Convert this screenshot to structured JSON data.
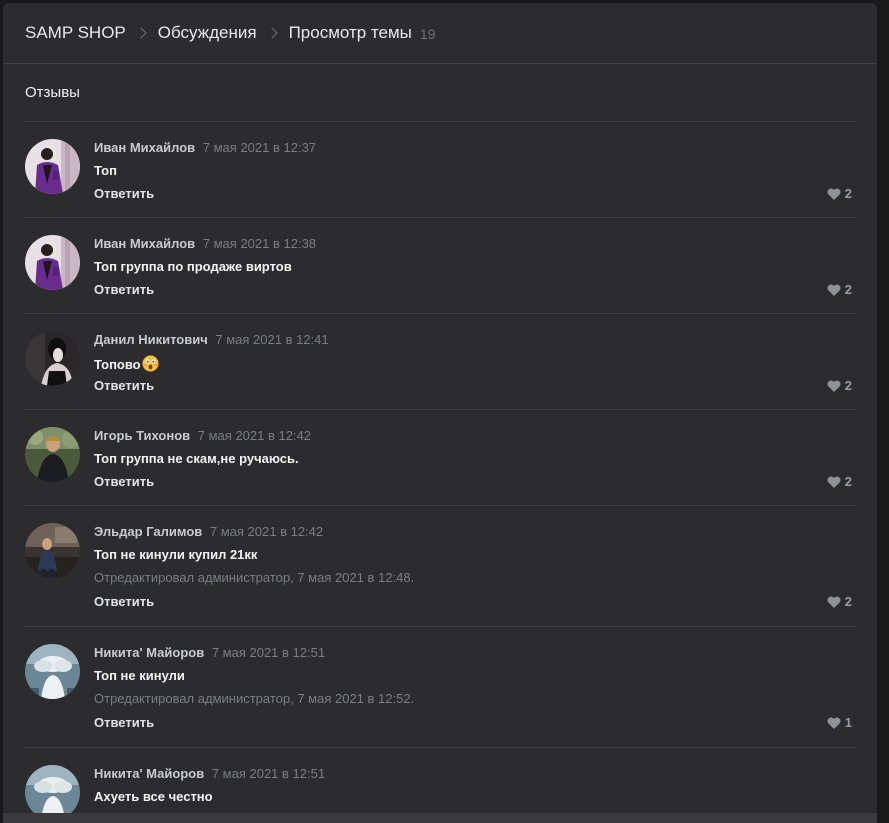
{
  "breadcrumb": {
    "items": [
      "SAMP SHOP",
      "Обсуждения",
      "Просмотр темы"
    ],
    "count": "19"
  },
  "topic": {
    "title": "Отзывы"
  },
  "comments": [
    {
      "author": "Иван Михайлов",
      "date": "7 мая 2021 в 12:37",
      "text": "Топ",
      "edited": "",
      "reply": "Ответить",
      "likes": "2",
      "avatar": "purple"
    },
    {
      "author": "Иван Михайлов",
      "date": "7 мая 2021 в 12:38",
      "text": "Топ группа по продаже виртов",
      "edited": "",
      "reply": "Ответить",
      "likes": "2",
      "avatar": "purple"
    },
    {
      "author": "Данил Никитович",
      "date": "7 мая 2021 в 12:41",
      "text": "Топово",
      "edited": "",
      "reply": "Ответить",
      "likes": "2",
      "avatar": "dark"
    },
    {
      "author": "Игорь Тихонов",
      "date": "7 мая 2021 в 12:42",
      "text": "Топ группа не скам,не ручаюсь.",
      "edited": "",
      "reply": "Ответить",
      "likes": "2",
      "avatar": "green"
    },
    {
      "author": "Эльдар Галимов",
      "date": "7 мая 2021 в 12:42",
      "text": "Топ не кинули купил 21кк",
      "edited": "Отредактировал администратор, 7 мая 2021 в 12:48.",
      "reply": "Ответить",
      "likes": "2",
      "avatar": "street"
    },
    {
      "author": "Никита' Майоров",
      "date": "7 мая 2021 в 12:51",
      "text": "Топ не кинули",
      "edited": "Отредактировал администратор, 7 мая 2021 в 12:52.",
      "reply": "Ответить",
      "likes": "1",
      "avatar": "sky"
    },
    {
      "author": "Никита' Майоров",
      "date": "7 мая 2021 в 12:51",
      "text": "Ахуеть все честно",
      "edited": "",
      "reply": "",
      "likes": "",
      "avatar": "sky"
    }
  ],
  "colors": {
    "background": "#19191a",
    "panel": "#2c2c2e",
    "divider": "#3f3f42",
    "muted": "#7b7e83"
  },
  "icons": {
    "like": "heart-icon",
    "breadcrumb_separator": "chevron-right-icon",
    "emoji": "astonished-face-emoji"
  }
}
